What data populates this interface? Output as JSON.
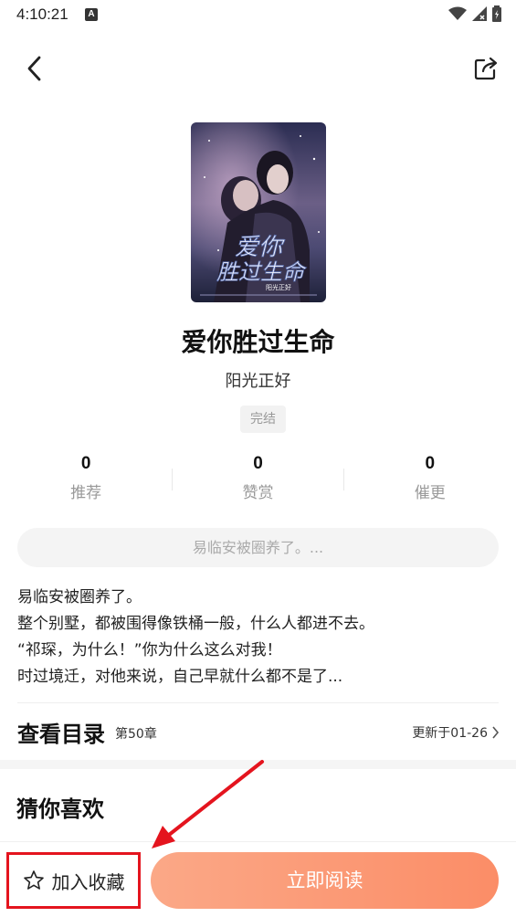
{
  "status_bar": {
    "time": "4:10:21",
    "notification_badge": "A"
  },
  "nav": {
    "back_icon": "chevron-left-icon",
    "share_icon": "share-icon"
  },
  "book": {
    "cover_title_line1": "爱你",
    "cover_title_line2": "胜过生命",
    "cover_author": "阳光正好",
    "title": "爱你胜过生命",
    "author": "阳光正好",
    "status_tag": "完结"
  },
  "stats": [
    {
      "value": "0",
      "label": "推荐"
    },
    {
      "value": "0",
      "label": "赞赏"
    },
    {
      "value": "0",
      "label": "催更"
    }
  ],
  "quote": "易临安被圈养了。...",
  "synopsis": [
    "易临安被圈养了。",
    "整个别墅，都被围得像铁桶一般，什么人都进不去。",
    "“祁琛，为什么！”你为什么这么对我！",
    "时过境迁，对他来说，自己早就什么都不是了..."
  ],
  "toc": {
    "title": "查看目录",
    "chapter": "第50章",
    "update": "更新于01-26"
  },
  "recommend": {
    "title": "猜你喜欢"
  },
  "bottom": {
    "favorite_label": "加入收藏",
    "read_label": "立即阅读"
  },
  "colors": {
    "accent_start": "#fba887",
    "accent_end": "#fb8d67",
    "highlight_red": "#e4141e"
  }
}
